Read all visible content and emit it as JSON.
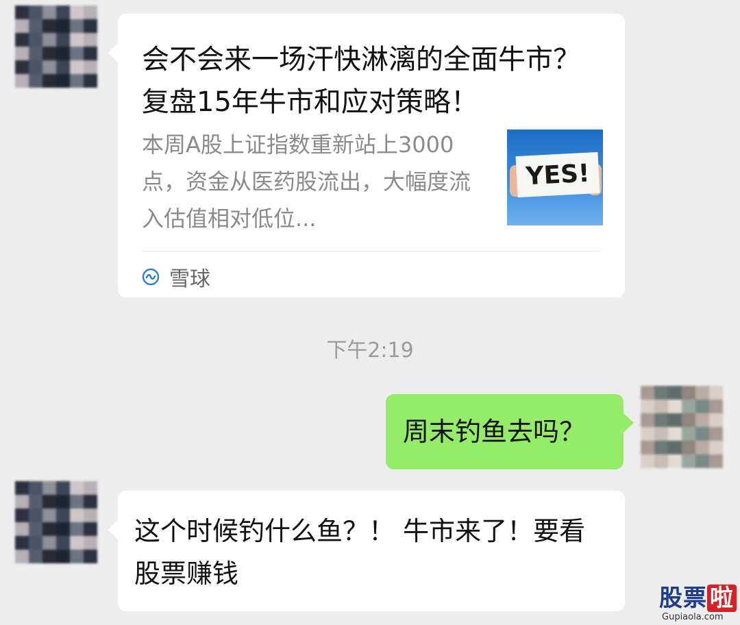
{
  "colors": {
    "background": "#ededed",
    "bubble_in": "#ffffff",
    "bubble_out": "#95ec69",
    "muted_text": "#8a8a8a",
    "source_icon": "#2f7bd6"
  },
  "messages": {
    "article_card": {
      "title": "会不会来一场汗快淋漓的全面牛市？复盘15年牛市和应对策略！",
      "description": "本周A股上证指数重新站上3000点，资金从医药股流出，大幅度流入估值相对低位...",
      "thumbnail_text": "YES!",
      "source_icon": "xueqiu-logo-icon",
      "source_name": "雪球"
    },
    "timestamp": "下午2:19",
    "outgoing_1": "周末钓鱼去吗？",
    "incoming_2": "这个时候钓什么鱼？！ 牛市来了！要看股票赚钱"
  },
  "watermark": {
    "main": "股票",
    "accent": "啦",
    "sub": "Gupiaola.com"
  }
}
